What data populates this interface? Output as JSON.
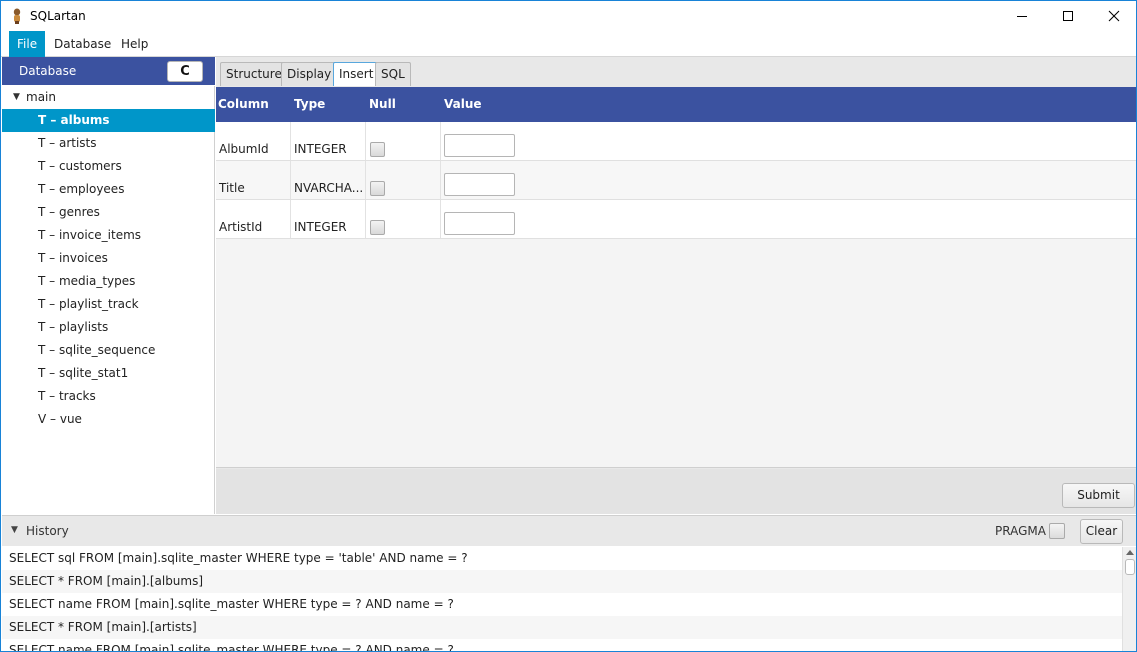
{
  "window": {
    "title": "SQLartan"
  },
  "menu": {
    "file": "File",
    "database": "Database",
    "help": "Help"
  },
  "sidebar": {
    "header": "Database",
    "refresh_icon": "C",
    "root": "main",
    "items": [
      "T – albums",
      "T – artists",
      "T – customers",
      "T – employees",
      "T – genres",
      "T – invoice_items",
      "T – invoices",
      "T – media_types",
      "T – playlist_track",
      "T – playlists",
      "T – sqlite_sequence",
      "T – sqlite_stat1",
      "T – tracks",
      "V – vue"
    ],
    "selected_index": 0
  },
  "tabs": {
    "structure": "Structure",
    "display": "Display",
    "insert": "Insert",
    "sql": "SQL",
    "active": "Insert"
  },
  "grid": {
    "headers": {
      "column": "Column",
      "type": "Type",
      "null": "Null",
      "value": "Value"
    },
    "rows": [
      {
        "column": "AlbumId",
        "type": "INTEGER",
        "value": ""
      },
      {
        "column": "Title",
        "type": "NVARCHA...",
        "value": ""
      },
      {
        "column": "ArtistId",
        "type": "INTEGER",
        "value": ""
      }
    ]
  },
  "submit_label": "Submit",
  "history": {
    "label": "History",
    "pragma_label": "PRAGMA",
    "clear_label": "Clear",
    "entries": [
      "SELECT sql FROM [main].sqlite_master WHERE type = 'table' AND name = ?",
      "SELECT * FROM [main].[albums]",
      "SELECT name FROM [main].sqlite_master WHERE type = ? AND name = ?",
      "SELECT * FROM [main].[artists]",
      "SELECT name FROM [main].sqlite_master WHERE type = ? AND name = ?"
    ]
  },
  "colors": {
    "accent": "#0096c9",
    "header_blue": "#3b52a0"
  }
}
